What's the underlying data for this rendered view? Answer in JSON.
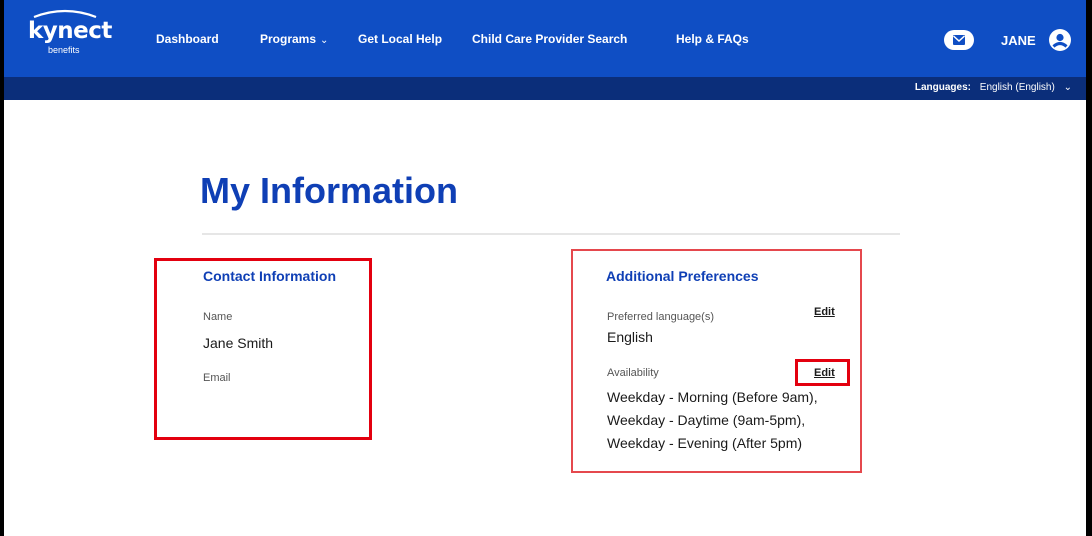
{
  "brand": {
    "name": "kynect",
    "sub": "benefits"
  },
  "nav": {
    "items": [
      {
        "label": "Dashboard"
      },
      {
        "label": "Programs"
      },
      {
        "label": "Get Local Help"
      },
      {
        "label": "Child Care Provider Search"
      },
      {
        "label": "Help & FAQs"
      }
    ],
    "programs_chevron": "⌄"
  },
  "user": {
    "name": "JANE"
  },
  "languages": {
    "label": "Languages:",
    "selected": "English (English)",
    "chevron": "⌄"
  },
  "page": {
    "title": "My Information"
  },
  "contact": {
    "heading": "Contact Information",
    "name_label": "Name",
    "name_value": "Jane Smith",
    "email_label": "Email"
  },
  "preferences": {
    "heading": "Additional Preferences",
    "language_label": "Preferred language(s)",
    "language_value": "English",
    "language_edit": "Edit",
    "availability_label": "Availability",
    "availability_edit": "Edit",
    "availability_lines": [
      "Weekday - Morning (Before 9am),",
      "Weekday - Daytime (9am-5pm),",
      "Weekday - Evening (After 5pm)"
    ]
  },
  "colors": {
    "nav_bg": "#0f4ec4",
    "lang_bar_bg": "#0b2e7a",
    "heading": "#0f3fb5",
    "highlight": "#e3000f"
  },
  "icons": {
    "mail": "mail-icon",
    "avatar": "user-avatar-icon",
    "chevron": "chevron-down-icon"
  }
}
